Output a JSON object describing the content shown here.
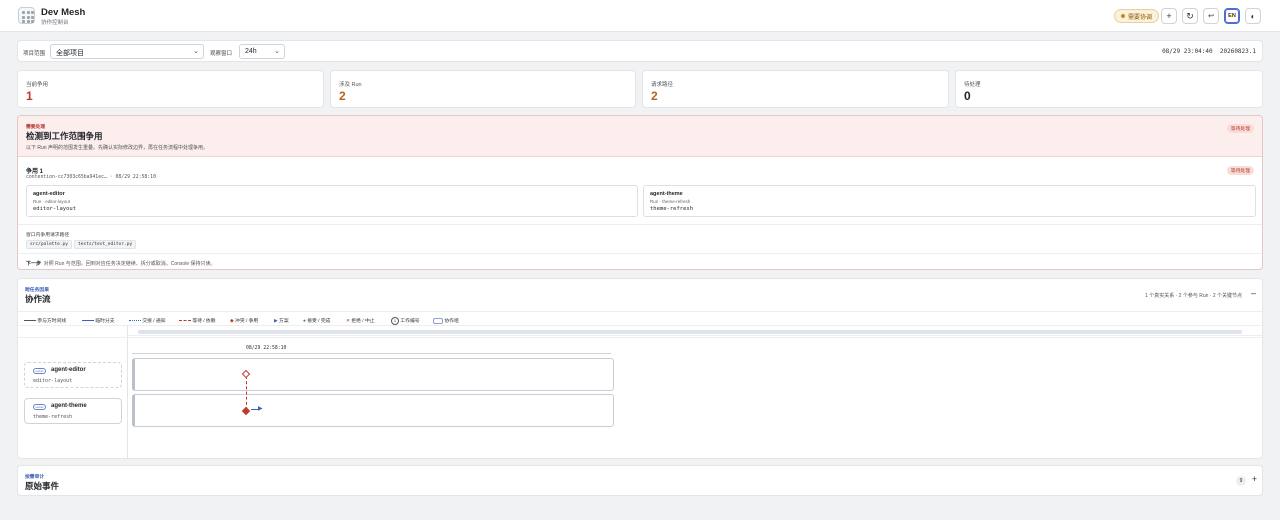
{
  "header": {
    "title": "Dev Mesh",
    "subtitle": "协作控制台",
    "coord_status": "需要协调",
    "lang_button": "EN"
  },
  "filters": {
    "scope_label": "项目范围",
    "scope_value": "全部项目",
    "window_label": "观察窗口",
    "window_value": "24h",
    "clock": "08/29 23:04:40",
    "version": "20260823.1"
  },
  "stats": [
    {
      "label": "当前争用",
      "value": "1",
      "color": "#c0392b"
    },
    {
      "label": "涉及 Run",
      "value": "2",
      "color": "#b5651d"
    },
    {
      "label": "请求路径",
      "value": "2",
      "color": "#b5651d"
    },
    {
      "label": "待处理",
      "value": "0",
      "color": "#1f2328"
    }
  ],
  "alert": {
    "eyebrow": "需要处理",
    "title": "检测到工作范围争用",
    "desc": "以下 Run 声明的范围发生重叠。先确认实际修改边界，再在任务流程中处理争用。",
    "badge": "等待处理",
    "contention": {
      "title": "争用 1",
      "id_line": "contention-cc7303c65ba941ec… · 08/29 22:58:10",
      "badge": "等待处理",
      "runs": [
        {
          "name": "agent-editor",
          "sub": "Run · editor-layout",
          "task": "editor-layout"
        },
        {
          "name": "agent-theme",
          "sub": "Run · theme-refresh",
          "task": "theme-refresh"
        }
      ],
      "paths_label": "窗口内争用请求路径",
      "paths": [
        "src/palette.py",
        "tests/test_editor.py"
      ],
      "next_label": "下一步",
      "next_text": "对照 Run 与范围。回到对应任务决定继续、拆分或取消。Console 保持只读。"
    }
  },
  "flow": {
    "eyebrow": "跨任务因果",
    "title": "协作流",
    "summary": "1 个真实关系 · 2 个参与 Run · 2 个关键节点",
    "collapse": "–",
    "legend": [
      "参与方时间线",
      "临时分支",
      "交接 / 通知",
      "等待 / 依赖",
      "冲突 / 争用",
      "方案",
      "接受 / 完成",
      "拒绝 / 中止",
      "工作编号",
      "协作组"
    ],
    "legend_num": "1",
    "timestamp": "08/29 22:58:10",
    "lanes": [
      {
        "tag": "owner",
        "name": "agent-editor",
        "sub": "editor-layout"
      },
      {
        "tag": "owner",
        "name": "agent-theme",
        "sub": "theme-refresh"
      }
    ]
  },
  "raw": {
    "eyebrow": "按需审计",
    "title": "原始事件",
    "count": "9",
    "expand": "+"
  },
  "colors": {
    "conflict": "#c0392b",
    "accent": "#3f5fb8",
    "done": "#2e8b57"
  }
}
